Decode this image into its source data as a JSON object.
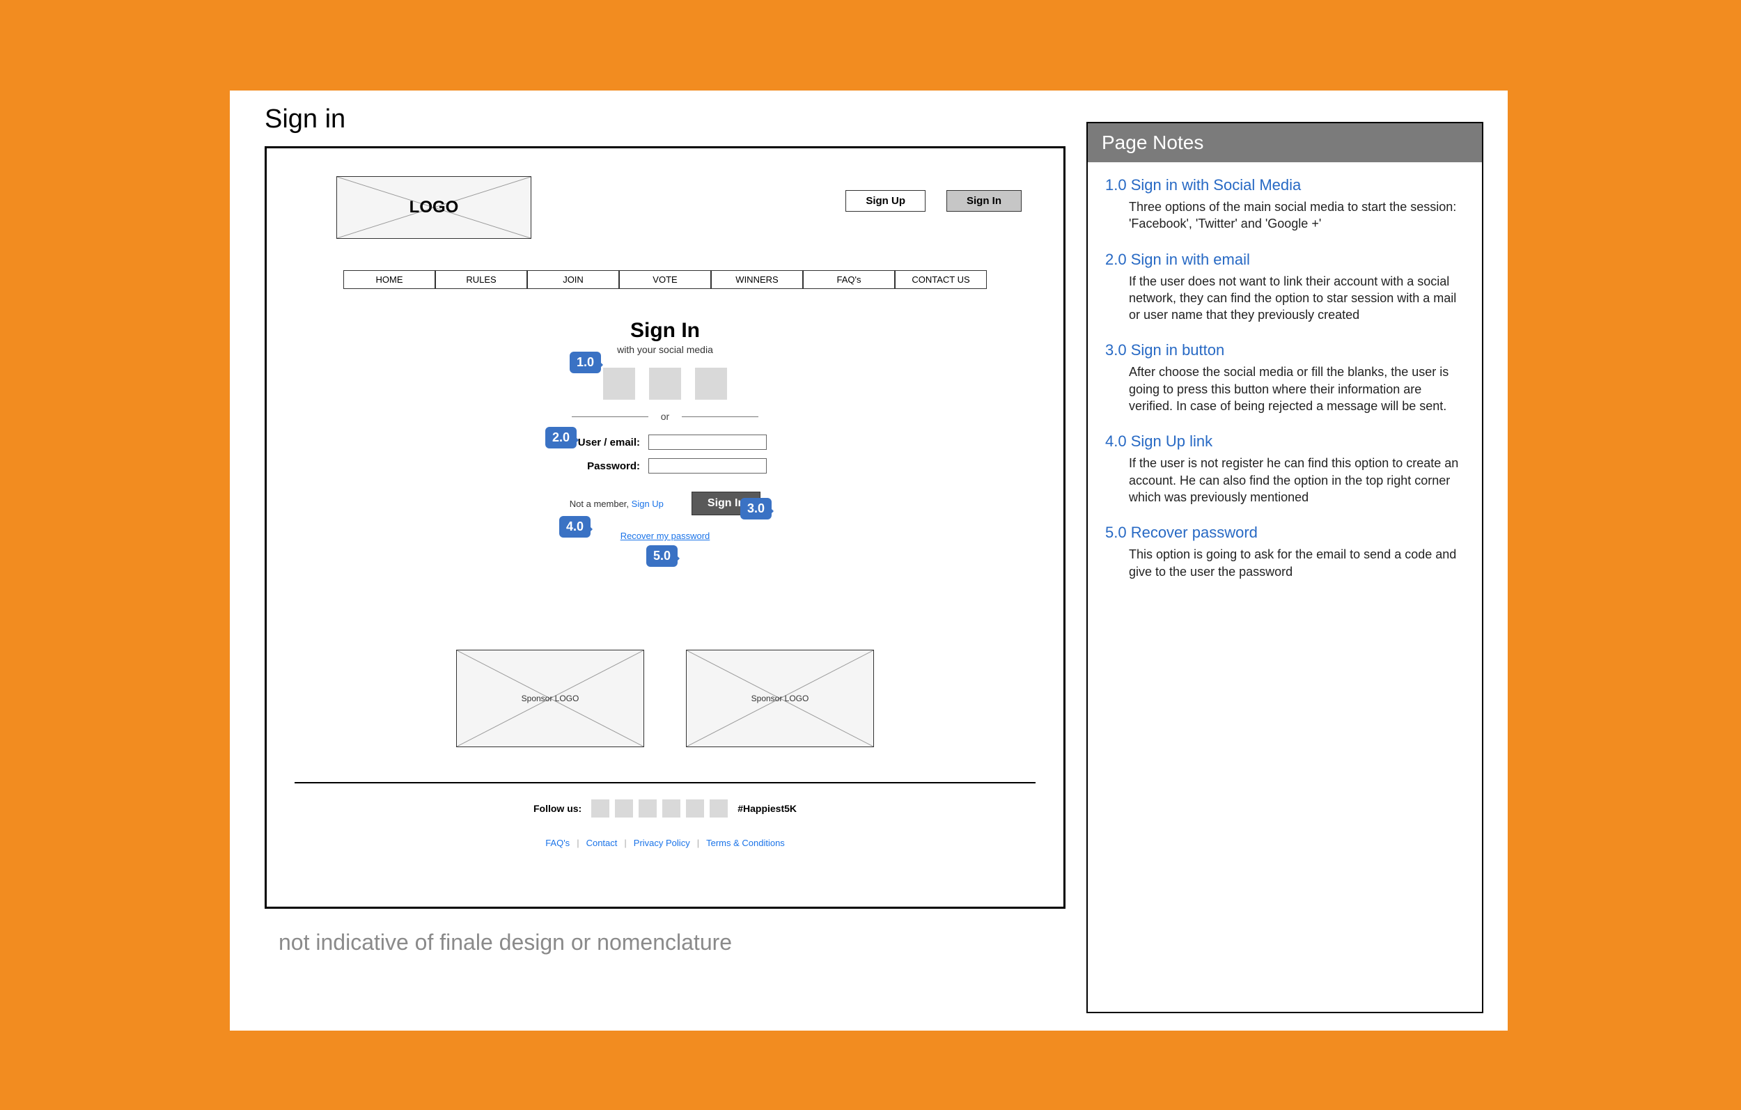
{
  "page_title": "Sign in",
  "disclaimer": "not indicative of finale design or nomenclature",
  "logo_label": "LOGO",
  "top_buttons": {
    "sign_up": "Sign Up",
    "sign_in": "Sign In"
  },
  "nav": [
    "HOME",
    "RULES",
    "JOIN",
    "VOTE",
    "WINNERS",
    "FAQ's",
    "CONTACT US"
  ],
  "signin": {
    "heading": "Sign In",
    "sub": "with your  social media",
    "or": "or",
    "labels": {
      "user": "User / email:",
      "password": "Password:"
    },
    "button": "Sign In",
    "not_member_prefix": "Not a member,",
    "sign_up_link": "Sign Up",
    "recover": "Recover my password"
  },
  "sponsor_label": "Sponsor LOGO",
  "follow": {
    "label": "Follow us:",
    "hashtag": "#Happiest5K"
  },
  "footer_links": [
    "FAQ's",
    "Contact",
    "Privacy Policy",
    "Terms & Conditions"
  ],
  "callouts": {
    "c1": "1.0",
    "c2": "2.0",
    "c3": "3.0",
    "c4": "4.0",
    "c5": "5.0"
  },
  "notes": {
    "header": "Page Notes",
    "items": [
      {
        "title": "1.0 Sign in with Social Media",
        "desc": "Three options of the main social media to start the session: 'Facebook', 'Twitter' and 'Google +'"
      },
      {
        "title": "2.0 Sign in with email",
        "desc": "If the user does not want to link their account with a social network, they can find the option to star session with a mail or user name that they previously created"
      },
      {
        "title": "3.0 Sign in button",
        "desc": "After choose the social media or fill the blanks, the user is going to press this button where their information are verified. In case of being rejected a message will be sent."
      },
      {
        "title": "4.0 Sign Up link",
        "desc": "If the user is not register he can find this option to create an account. He can also find the option in the top right corner which was previously mentioned"
      },
      {
        "title": "5.0 Recover password",
        "desc": "This option is going to ask for the email to send a code and give to the user the password"
      }
    ]
  }
}
